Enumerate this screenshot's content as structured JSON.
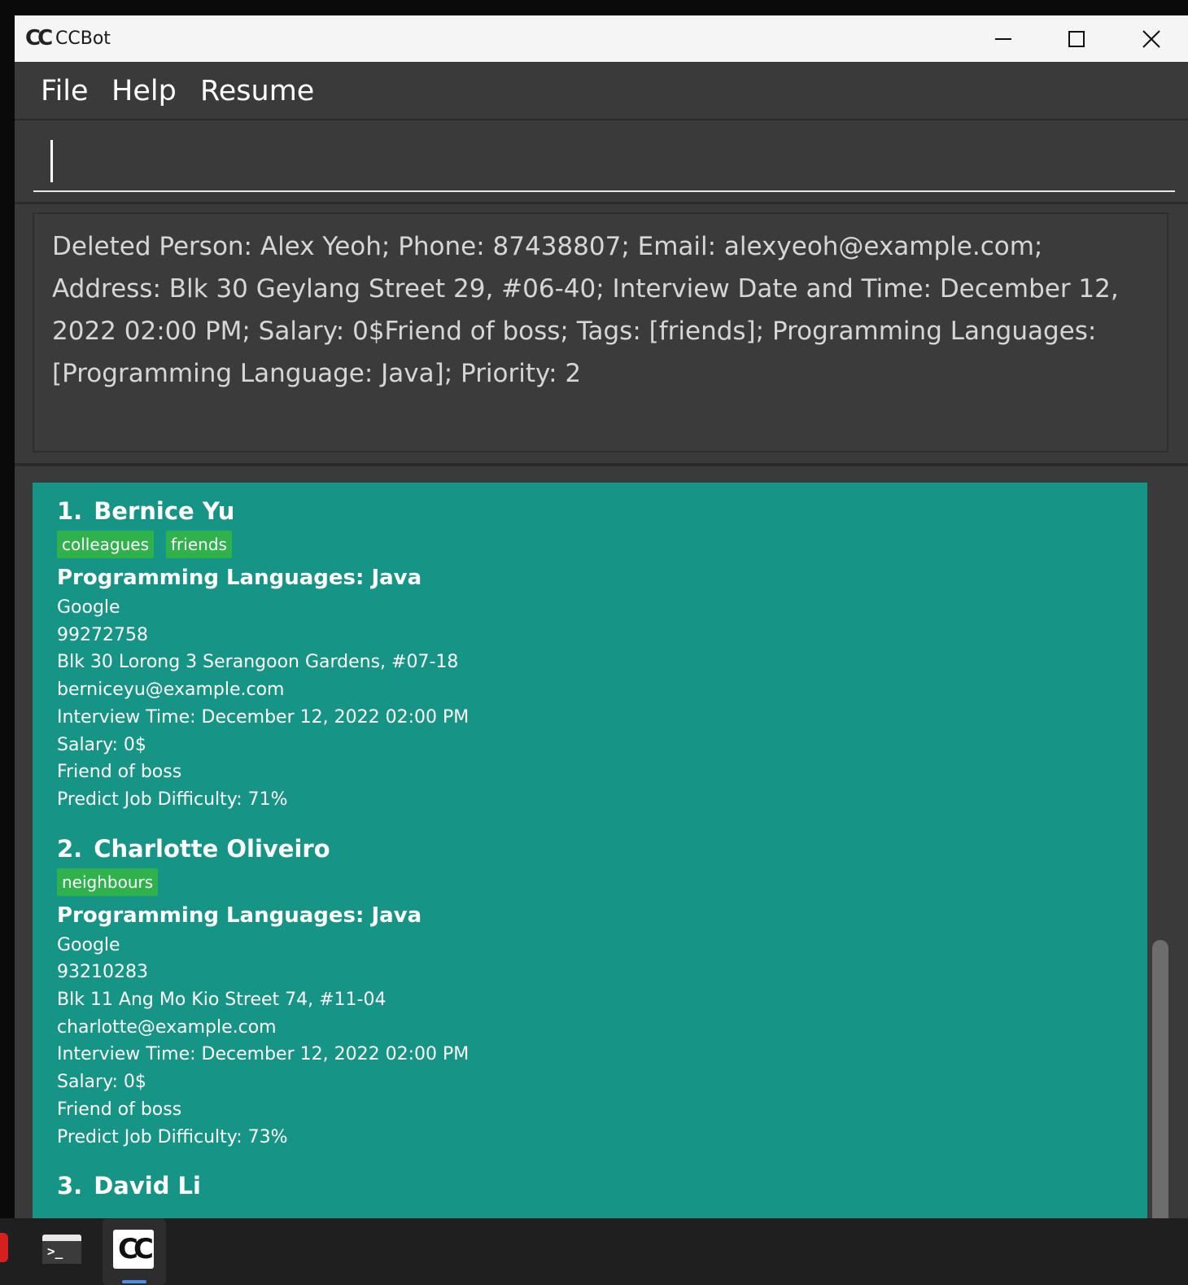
{
  "window": {
    "logo_text": "CC",
    "title": "CCBot"
  },
  "menu": {
    "items": [
      "File",
      "Help",
      "Resume"
    ]
  },
  "command": {
    "value": "",
    "placeholder": ""
  },
  "result_display": {
    "text": "Deleted Person: Alex Yeoh; Phone: 87438807; Email: alexyeoh@example.com; Address: Blk 30 Geylang Street 29, #06-40; Interview Date and Time: December 12, 2022 02:00 PM; Salary: 0$Friend of boss; Tags: [friends]; Programming Languages: [Programming Language: Java]; Priority: 2"
  },
  "persons": [
    {
      "index": "1.",
      "name": "Bernice Yu",
      "tags": [
        "colleagues",
        "friends"
      ],
      "languages": "Programming Languages: Java",
      "company": "Google",
      "phone": "99272758",
      "address": "Blk 30 Lorong 3 Serangoon Gardens, #07-18",
      "email": "berniceyu@example.com",
      "interview": "Interview Time: December 12, 2022 02:00 PM",
      "salary": "Salary: 0$",
      "note": "Friend of boss",
      "difficulty": "Predict Job Difficulty: 71%"
    },
    {
      "index": "2.",
      "name": "Charlotte Oliveiro",
      "tags": [
        "neighbours"
      ],
      "languages": "Programming Languages: Java",
      "company": "Google",
      "phone": "93210283",
      "address": "Blk 11 Ang Mo Kio Street 74, #11-04",
      "email": "charlotte@example.com",
      "interview": "Interview Time: December 12, 2022 02:00 PM",
      "salary": "Salary: 0$",
      "note": "Friend of boss",
      "difficulty": "Predict Job Difficulty: 73%"
    },
    {
      "index": "3.",
      "name": "David Li"
    }
  ],
  "taskbar": {
    "app_logo_text": "CC"
  },
  "colors": {
    "card_background": "#169586",
    "tag_background": "#2fb24c",
    "window_background": "#3a3a3a"
  }
}
